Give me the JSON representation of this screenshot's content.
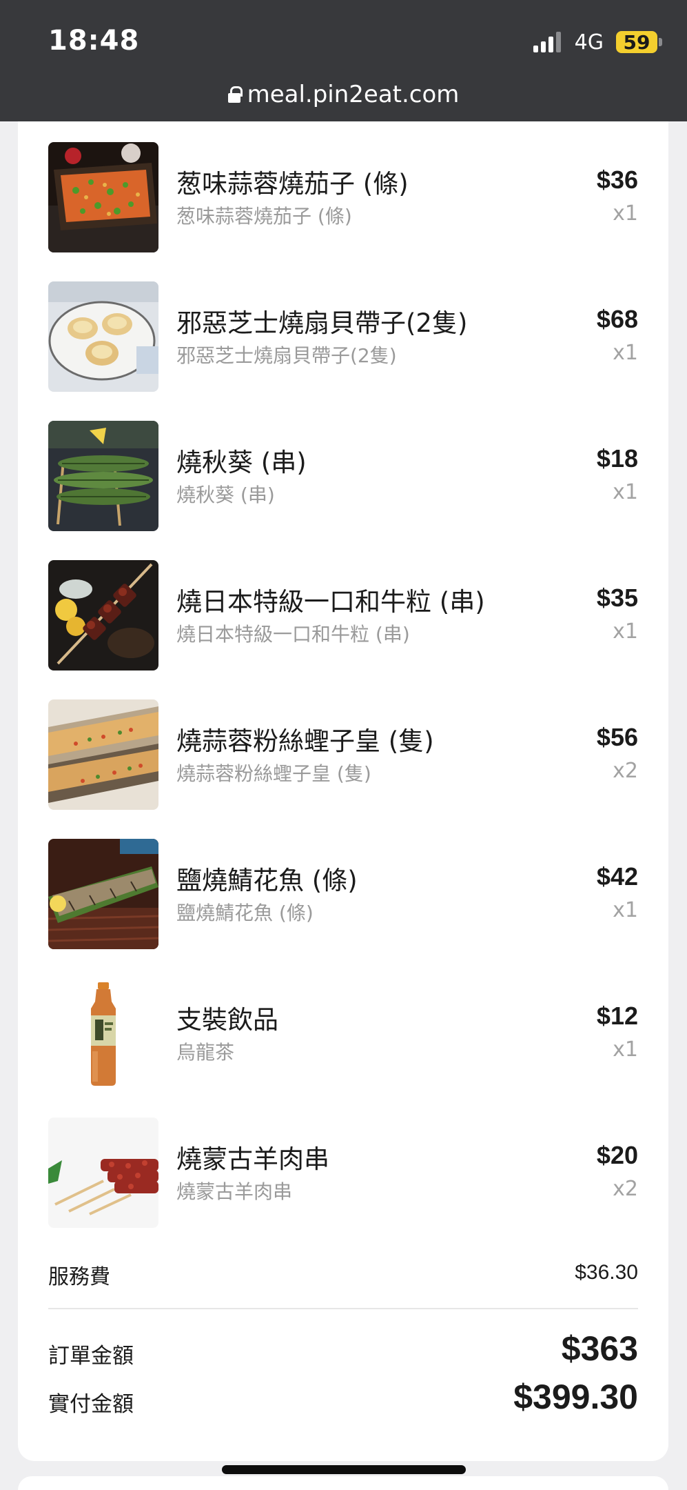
{
  "status_bar": {
    "time": "18:48",
    "network": "4G",
    "battery": "59",
    "battery_color": "#f4cf2e"
  },
  "browser": {
    "url": "meal.pin2eat.com"
  },
  "items": [
    {
      "name": "葱味蒜蓉燒茄子 (條)",
      "desc": "葱味蒜蓉燒茄子 (條)",
      "price": "$36",
      "qty": "x1",
      "image": "grilled-eggplant-image"
    },
    {
      "name": "邪惡芝士燒扇貝帶子(2隻)",
      "desc": "邪惡芝士燒扇貝帶子(2隻)",
      "price": "$68",
      "qty": "x1",
      "image": "cheese-scallop-image"
    },
    {
      "name": "燒秋葵 (串)",
      "desc": "燒秋葵 (串)",
      "price": "$18",
      "qty": "x1",
      "image": "grilled-okra-image"
    },
    {
      "name": "燒日本特級一口和牛粒 (串)",
      "desc": "燒日本特級一口和牛粒 (串)",
      "price": "$35",
      "qty": "x1",
      "image": "wagyu-skewer-image"
    },
    {
      "name": "燒蒜蓉粉絲蟶子皇 (隻)",
      "desc": "燒蒜蓉粉絲蟶子皇 (隻)",
      "price": "$56",
      "qty": "x2",
      "image": "razor-clam-image"
    },
    {
      "name": "鹽燒鯖花魚 (條)",
      "desc": "鹽燒鯖花魚 (條)",
      "price": "$42",
      "qty": "x1",
      "image": "grilled-mackerel-image"
    },
    {
      "name": "支裝飲品",
      "desc": "烏龍茶",
      "price": "$12",
      "qty": "x1",
      "image": "oolong-tea-bottle-image"
    },
    {
      "name": "燒蒙古羊肉串",
      "desc": "燒蒙古羊肉串",
      "price": "$20",
      "qty": "x2",
      "image": "lamb-skewer-image"
    }
  ],
  "summary": {
    "service_fee_label": "服務費",
    "service_fee": "$36.30",
    "order_total_label": "訂單金額",
    "order_total": "$363",
    "paid_label": "實付金額",
    "paid_total": "$399.30"
  }
}
